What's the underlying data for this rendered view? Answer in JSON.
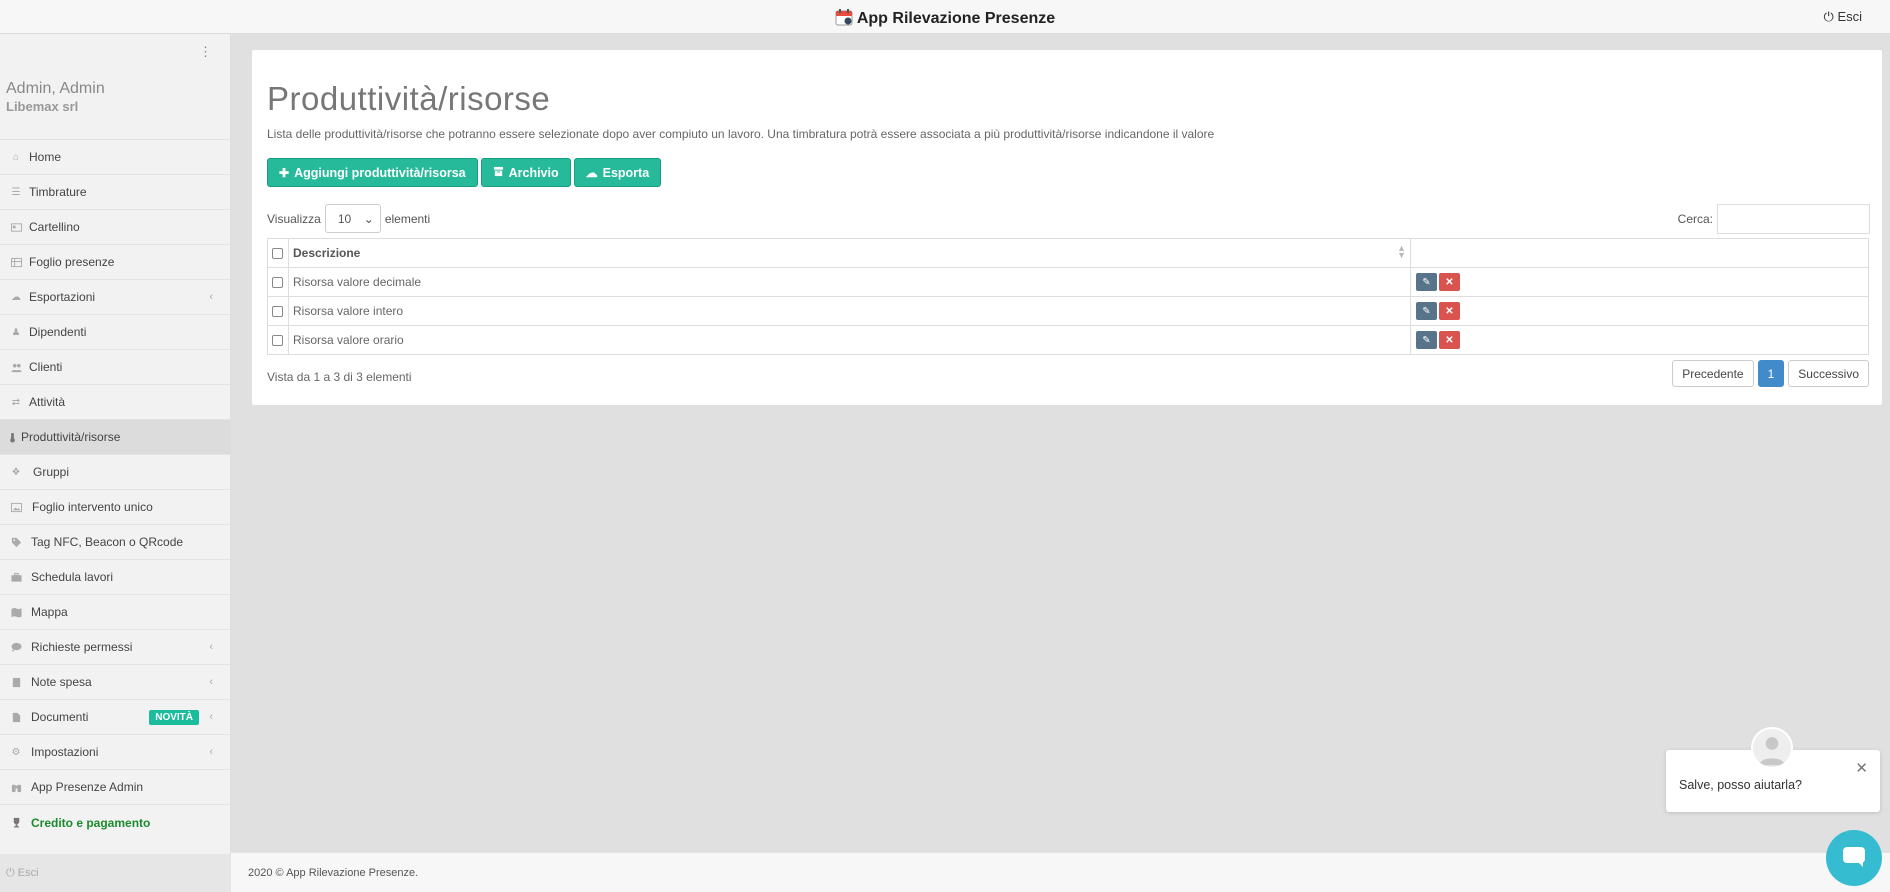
{
  "topbar": {
    "app_title": "App Rilevazione Presenze",
    "logout_label": "Esci"
  },
  "sidebar": {
    "user_name": "Admin, Admin",
    "company": "Libemax srl",
    "items": [
      {
        "label": "Home",
        "icon": "home-icon",
        "active": false,
        "submenu": false
      },
      {
        "label": "Timbrature",
        "icon": "list-icon",
        "active": false,
        "submenu": false
      },
      {
        "label": "Cartellino",
        "icon": "id-card-icon",
        "active": false,
        "submenu": false
      },
      {
        "label": "Foglio presenze",
        "icon": "table-icon",
        "active": false,
        "submenu": false
      },
      {
        "label": "Esportazioni",
        "icon": "cloud-icon",
        "active": false,
        "submenu": true
      },
      {
        "label": "Dipendenti",
        "icon": "user-icon",
        "active": false,
        "submenu": false
      },
      {
        "label": "Clienti",
        "icon": "users-icon",
        "active": false,
        "submenu": false
      },
      {
        "label": "Attività",
        "icon": "signpost-icon",
        "active": false,
        "submenu": false
      },
      {
        "label": "Produttività/risorse",
        "icon": "thermometer-icon",
        "active": true,
        "submenu": false
      },
      {
        "label": "Gruppi",
        "icon": "cubes-icon",
        "active": false,
        "submenu": false
      },
      {
        "label": "Foglio intervento unico",
        "icon": "image-icon",
        "active": false,
        "submenu": false
      },
      {
        "label": "Tag NFC, Beacon o QRcode",
        "icon": "tags-icon",
        "active": false,
        "submenu": false
      },
      {
        "label": "Schedula lavori",
        "icon": "briefcase-icon",
        "active": false,
        "submenu": false
      },
      {
        "label": "Mappa",
        "icon": "map-icon",
        "active": false,
        "submenu": false
      },
      {
        "label": "Richieste permessi",
        "icon": "comment-icon",
        "active": false,
        "submenu": true
      },
      {
        "label": "Note spesa",
        "icon": "note-icon",
        "active": false,
        "submenu": true
      },
      {
        "label": "Documenti",
        "icon": "file-icon",
        "active": false,
        "submenu": true,
        "badge": "NOVITÀ"
      },
      {
        "label": "Impostazioni",
        "icon": "cogs-icon",
        "active": false,
        "submenu": true
      },
      {
        "label": "App Presenze Admin",
        "icon": "binoculars-icon",
        "active": false,
        "submenu": false
      },
      {
        "label": "Credito e pagamento",
        "icon": "trophy-icon",
        "active": false,
        "submenu": false
      }
    ],
    "footer_logout": "Esci"
  },
  "main": {
    "title": "Produttività/risorse",
    "description": "Lista delle produttività/risorse che potranno essere selezionate dopo aver compiuto un lavoro. Una timbratura potrà essere associata a più produttività/risorse indicandone il valore",
    "buttons": {
      "add": "Aggiungi produttività/risorsa",
      "archive": "Archivio",
      "export": "Esporta"
    },
    "length": {
      "prefix": "Visualizza",
      "value": "10",
      "suffix": "elementi"
    },
    "search_label": "Cerca:",
    "table": {
      "header": "Descrizione",
      "rows": [
        "Risorsa valore decimale",
        "Risorsa valore intero",
        "Risorsa valore orario"
      ]
    },
    "info": "Vista da 1 a 3 di 3 elementi",
    "pagination": {
      "prev": "Precedente",
      "current": "1",
      "next": "Successivo"
    }
  },
  "footer": {
    "text": "2020 © App Rilevazione Presenze."
  },
  "chat": {
    "message": "Salve, posso aiutarla?"
  },
  "colors": {
    "accent": "#26b99a",
    "primary": "#428bca",
    "danger": "#d9534f",
    "chat": "#35bcd0"
  }
}
